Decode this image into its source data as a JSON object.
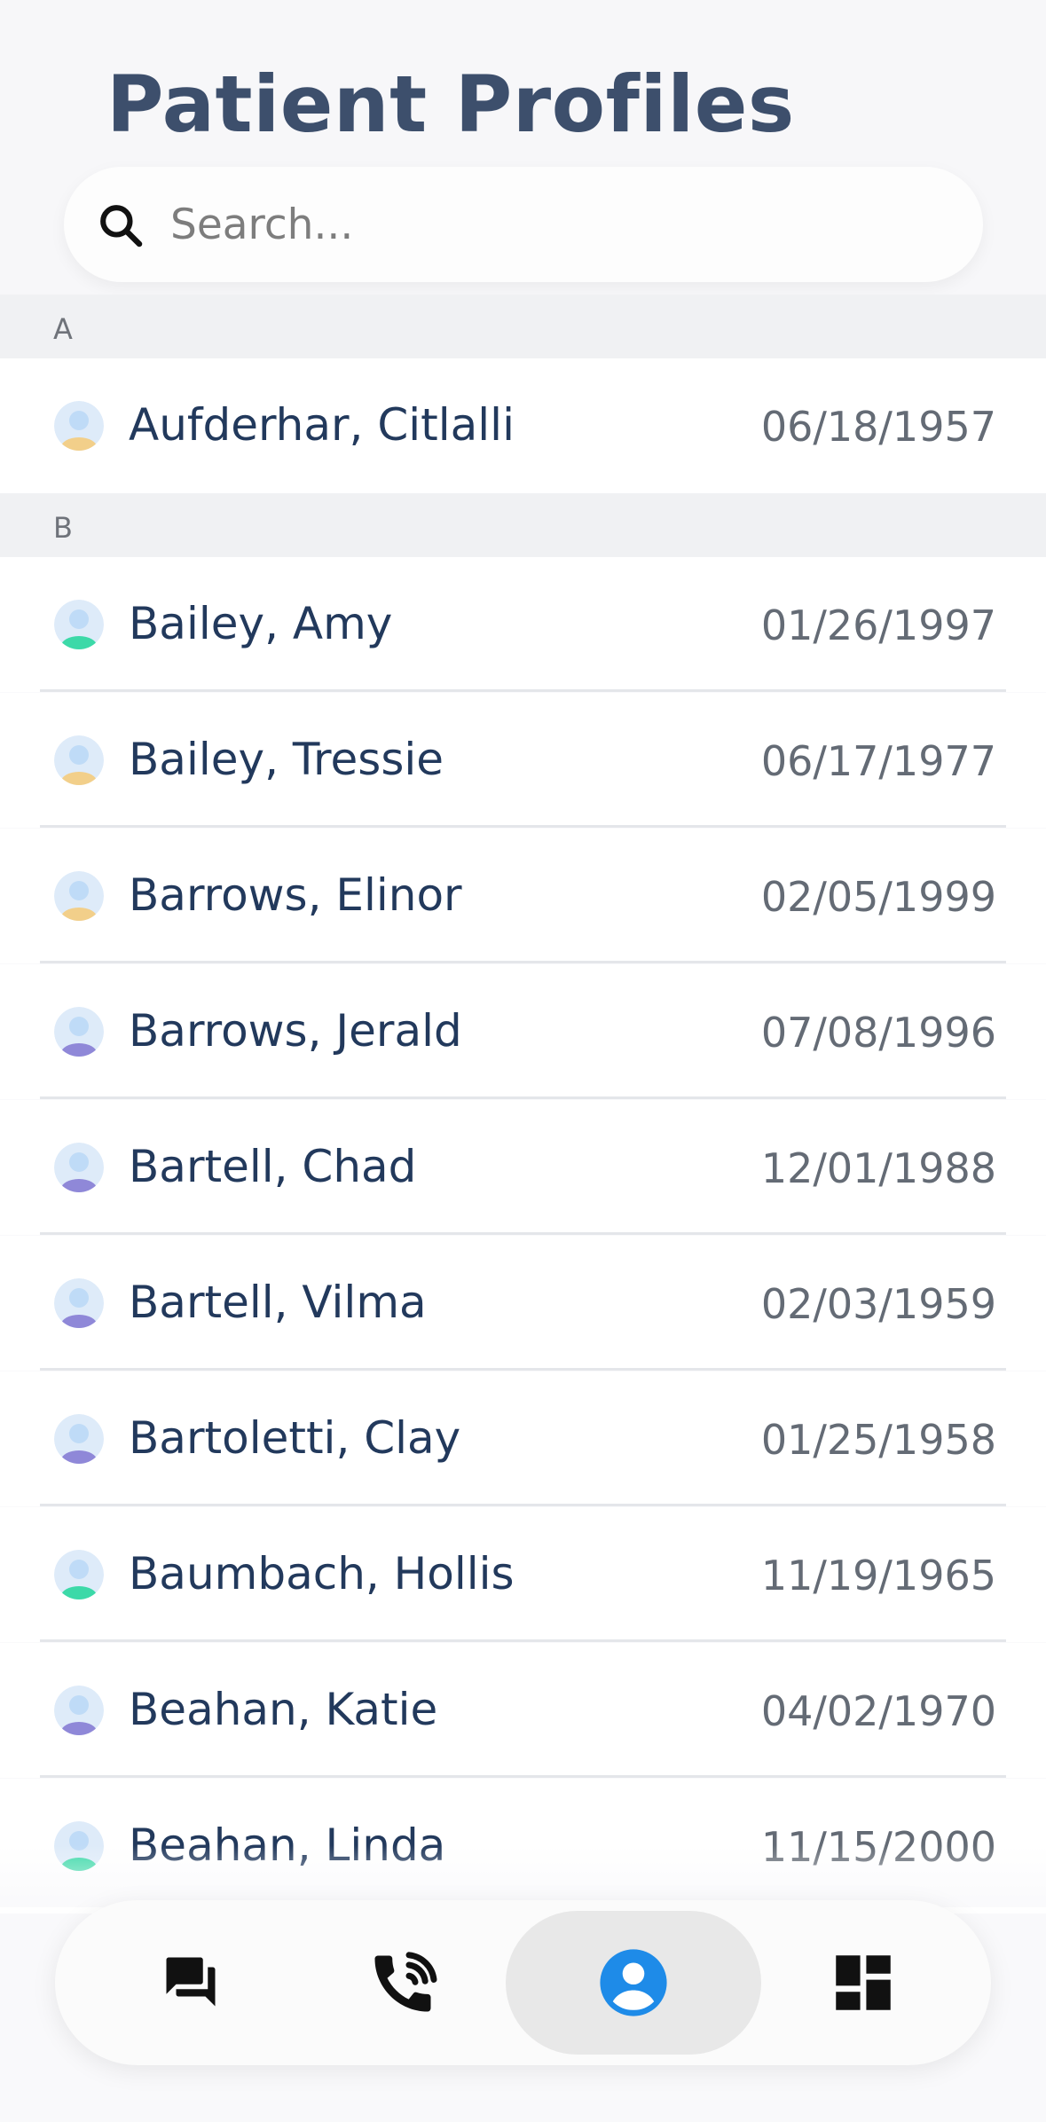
{
  "header": {
    "title": "Patient Profiles"
  },
  "search": {
    "placeholder": "Search...",
    "value": "",
    "icon": "search-icon"
  },
  "sections": [
    {
      "letter": "A",
      "patients": [
        {
          "name": "Aufderhar, Citlalli",
          "dob": "06/18/1957",
          "avatar_color": "#f2cf8a"
        }
      ]
    },
    {
      "letter": "B",
      "patients": [
        {
          "name": "Bailey, Amy",
          "dob": "01/26/1997",
          "avatar_color": "#3cd9a8"
        },
        {
          "name": "Bailey, Tressie",
          "dob": "06/17/1977",
          "avatar_color": "#f2cf8a"
        },
        {
          "name": "Barrows, Elinor",
          "dob": "02/05/1999",
          "avatar_color": "#f2cf8a"
        },
        {
          "name": "Barrows, Jerald",
          "dob": "07/08/1996",
          "avatar_color": "#8f88d8"
        },
        {
          "name": "Bartell, Chad",
          "dob": "12/01/1988",
          "avatar_color": "#8f88d8"
        },
        {
          "name": "Bartell, Vilma",
          "dob": "02/03/1959",
          "avatar_color": "#8f88d8"
        },
        {
          "name": "Bartoletti, Clay",
          "dob": "01/25/1958",
          "avatar_color": "#8f88d8"
        },
        {
          "name": "Baumbach, Hollis",
          "dob": "11/19/1965",
          "avatar_color": "#3cd9a8"
        },
        {
          "name": "Beahan, Katie",
          "dob": "04/02/1970",
          "avatar_color": "#8f88d8"
        },
        {
          "name": "Beahan, Linda",
          "dob": "11/15/2000",
          "avatar_color": "#3cd9a8"
        }
      ]
    }
  ],
  "nav": {
    "items": [
      {
        "icon": "chat-icon",
        "active": false
      },
      {
        "icon": "phone-call-icon",
        "active": false
      },
      {
        "icon": "profile-icon",
        "active": true
      },
      {
        "icon": "dashboard-icon",
        "active": false
      }
    ],
    "accent": "#1e8be8",
    "icon_color": "#111111"
  },
  "colors": {
    "title": "#3d4f6c",
    "name": "#22395c",
    "date": "#646b75",
    "section_bg": "#f0f1f3",
    "avatar_head": "#bfdbf7"
  }
}
